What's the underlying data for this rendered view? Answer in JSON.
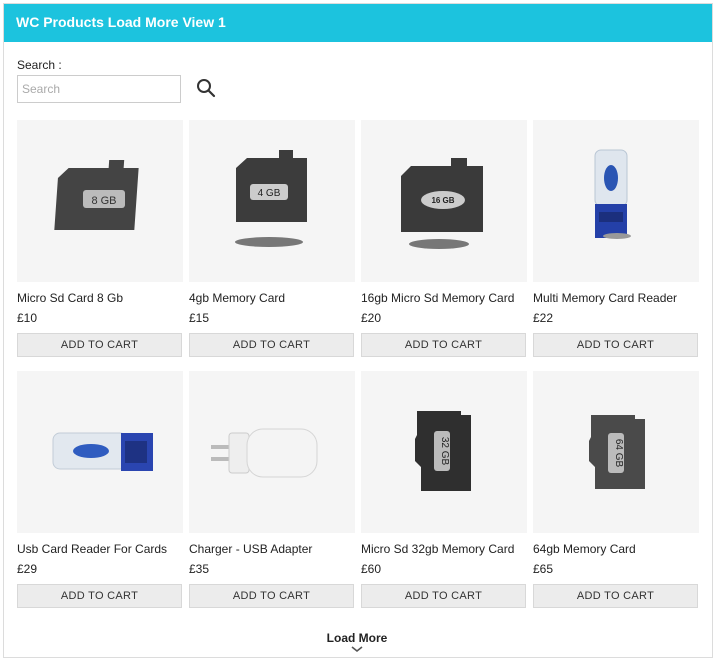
{
  "header": {
    "title": "WC Products Load More View 1"
  },
  "search": {
    "label": "Search :",
    "placeholder": "Search",
    "value": "",
    "icon": "search-icon"
  },
  "products": [
    {
      "name": "Micro Sd Card 8 Gb",
      "price": "£10",
      "cart_label": "ADD TO CART",
      "image_label": "8 GB",
      "icon": "sd-card-icon"
    },
    {
      "name": "4gb Memory Card",
      "price": "£15",
      "cart_label": "ADD TO CART",
      "image_label": "4 GB",
      "icon": "sd-card-icon"
    },
    {
      "name": "16gb Micro Sd Memory Card",
      "price": "£20",
      "cart_label": "ADD TO CART",
      "image_label": "16 GB",
      "icon": "sd-card-icon"
    },
    {
      "name": "Multi Memory Card Reader",
      "price": "£22",
      "cart_label": "ADD TO CART",
      "image_label": "",
      "icon": "card-reader-icon"
    },
    {
      "name": "Usb Card Reader For Cards",
      "price": "£29",
      "cart_label": "ADD TO CART",
      "image_label": "",
      "icon": "usb-reader-icon"
    },
    {
      "name": "Charger - USB Adapter",
      "price": "£35",
      "cart_label": "ADD TO CART",
      "image_label": "",
      "icon": "charger-icon"
    },
    {
      "name": "Micro Sd 32gb Memory Card",
      "price": "£60",
      "cart_label": "ADD TO CART",
      "image_label": "32 GB",
      "icon": "sd-card-icon"
    },
    {
      "name": "64gb Memory Card",
      "price": "£65",
      "cart_label": "ADD TO CART",
      "image_label": "64 GB",
      "icon": "sd-card-icon"
    }
  ],
  "load_more": {
    "label": "Load More",
    "icon": "chevron-down-icon"
  }
}
